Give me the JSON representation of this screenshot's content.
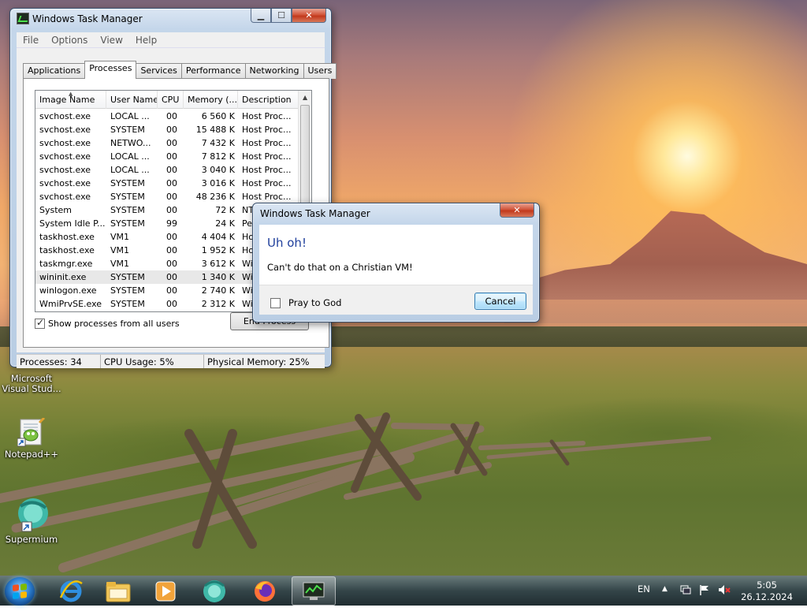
{
  "taskmgr": {
    "title": "Windows Task Manager",
    "menu": [
      "File",
      "Options",
      "View",
      "Help"
    ],
    "tabs": [
      "Applications",
      "Processes",
      "Services",
      "Performance",
      "Networking",
      "Users"
    ],
    "active_tab": 1,
    "columns": [
      "Image Name",
      "User Name",
      "CPU",
      "Memory (...",
      "Description"
    ],
    "rows": [
      {
        "image": "svchost.exe",
        "user": "LOCAL ...",
        "cpu": "00",
        "mem": "6 560 K",
        "desc": "Host Proc..."
      },
      {
        "image": "svchost.exe",
        "user": "SYSTEM",
        "cpu": "00",
        "mem": "15 488 K",
        "desc": "Host Proc..."
      },
      {
        "image": "svchost.exe",
        "user": "NETWO...",
        "cpu": "00",
        "mem": "7 432 K",
        "desc": "Host Proc..."
      },
      {
        "image": "svchost.exe",
        "user": "LOCAL ...",
        "cpu": "00",
        "mem": "7 812 K",
        "desc": "Host Proc..."
      },
      {
        "image": "svchost.exe",
        "user": "LOCAL ...",
        "cpu": "00",
        "mem": "3 040 K",
        "desc": "Host Proc..."
      },
      {
        "image": "svchost.exe",
        "user": "SYSTEM",
        "cpu": "00",
        "mem": "3 016 K",
        "desc": "Host Proc..."
      },
      {
        "image": "svchost.exe",
        "user": "SYSTEM",
        "cpu": "00",
        "mem": "48 236 K",
        "desc": "Host Proc..."
      },
      {
        "image": "System",
        "user": "SYSTEM",
        "cpu": "00",
        "mem": "72 K",
        "desc": "NT Kernel..."
      },
      {
        "image": "System Idle P...",
        "user": "SYSTEM",
        "cpu": "99",
        "mem": "24 K",
        "desc": "Per..."
      },
      {
        "image": "taskhost.exe",
        "user": "VM1",
        "cpu": "00",
        "mem": "4 404 K",
        "desc": "Host..."
      },
      {
        "image": "taskhost.exe",
        "user": "VM1",
        "cpu": "00",
        "mem": "1 952 K",
        "desc": "Host..."
      },
      {
        "image": "taskmgr.exe",
        "user": "VM1",
        "cpu": "00",
        "mem": "3 612 K",
        "desc": "Win..."
      },
      {
        "image": "wininit.exe",
        "user": "SYSTEM",
        "cpu": "00",
        "mem": "1 340 K",
        "desc": "Win..."
      },
      {
        "image": "winlogon.exe",
        "user": "SYSTEM",
        "cpu": "00",
        "mem": "2 740 K",
        "desc": "Win..."
      },
      {
        "image": "WmiPrvSE.exe",
        "user": "SYSTEM",
        "cpu": "00",
        "mem": "2 312 K",
        "desc": "Win..."
      }
    ],
    "selected_row": 12,
    "show_all_label": "Show processes from all users",
    "show_all_checked": true,
    "end_process_label": "End Process",
    "status": {
      "processes": "Processes: 34",
      "cpu": "CPU Usage: 5%",
      "memory": "Physical Memory: 25%"
    }
  },
  "dialog": {
    "title": "Windows Task Manager",
    "heading": "Uh oh!",
    "message": "Can't do that on a Christian VM!",
    "checkbox_label": "Pray to God",
    "checkbox_checked": false,
    "cancel_label": "Cancel"
  },
  "desktop_icons": [
    {
      "label_line1": "Microsoft",
      "label_line2": "Visual Stud...",
      "icon": "visual-studio-icon"
    },
    {
      "label_line1": "Notepad++",
      "label_line2": "",
      "icon": "notepad-plus-plus-icon"
    },
    {
      "label_line1": "Supermium",
      "label_line2": "",
      "icon": "supermium-icon"
    }
  ],
  "taskbar": {
    "pinned": [
      "internet-explorer-icon",
      "file-explorer-icon",
      "media-player-icon",
      "supermium-icon",
      "firefox-icon",
      "task-manager-icon"
    ],
    "active_index": 5,
    "language": "EN",
    "time": "5:05",
    "date": "26.12.2024"
  },
  "colors": {
    "dialog_heading": "#1f3f9c",
    "close_button": "#c2391c",
    "selected_row": "#e8e8e8"
  }
}
